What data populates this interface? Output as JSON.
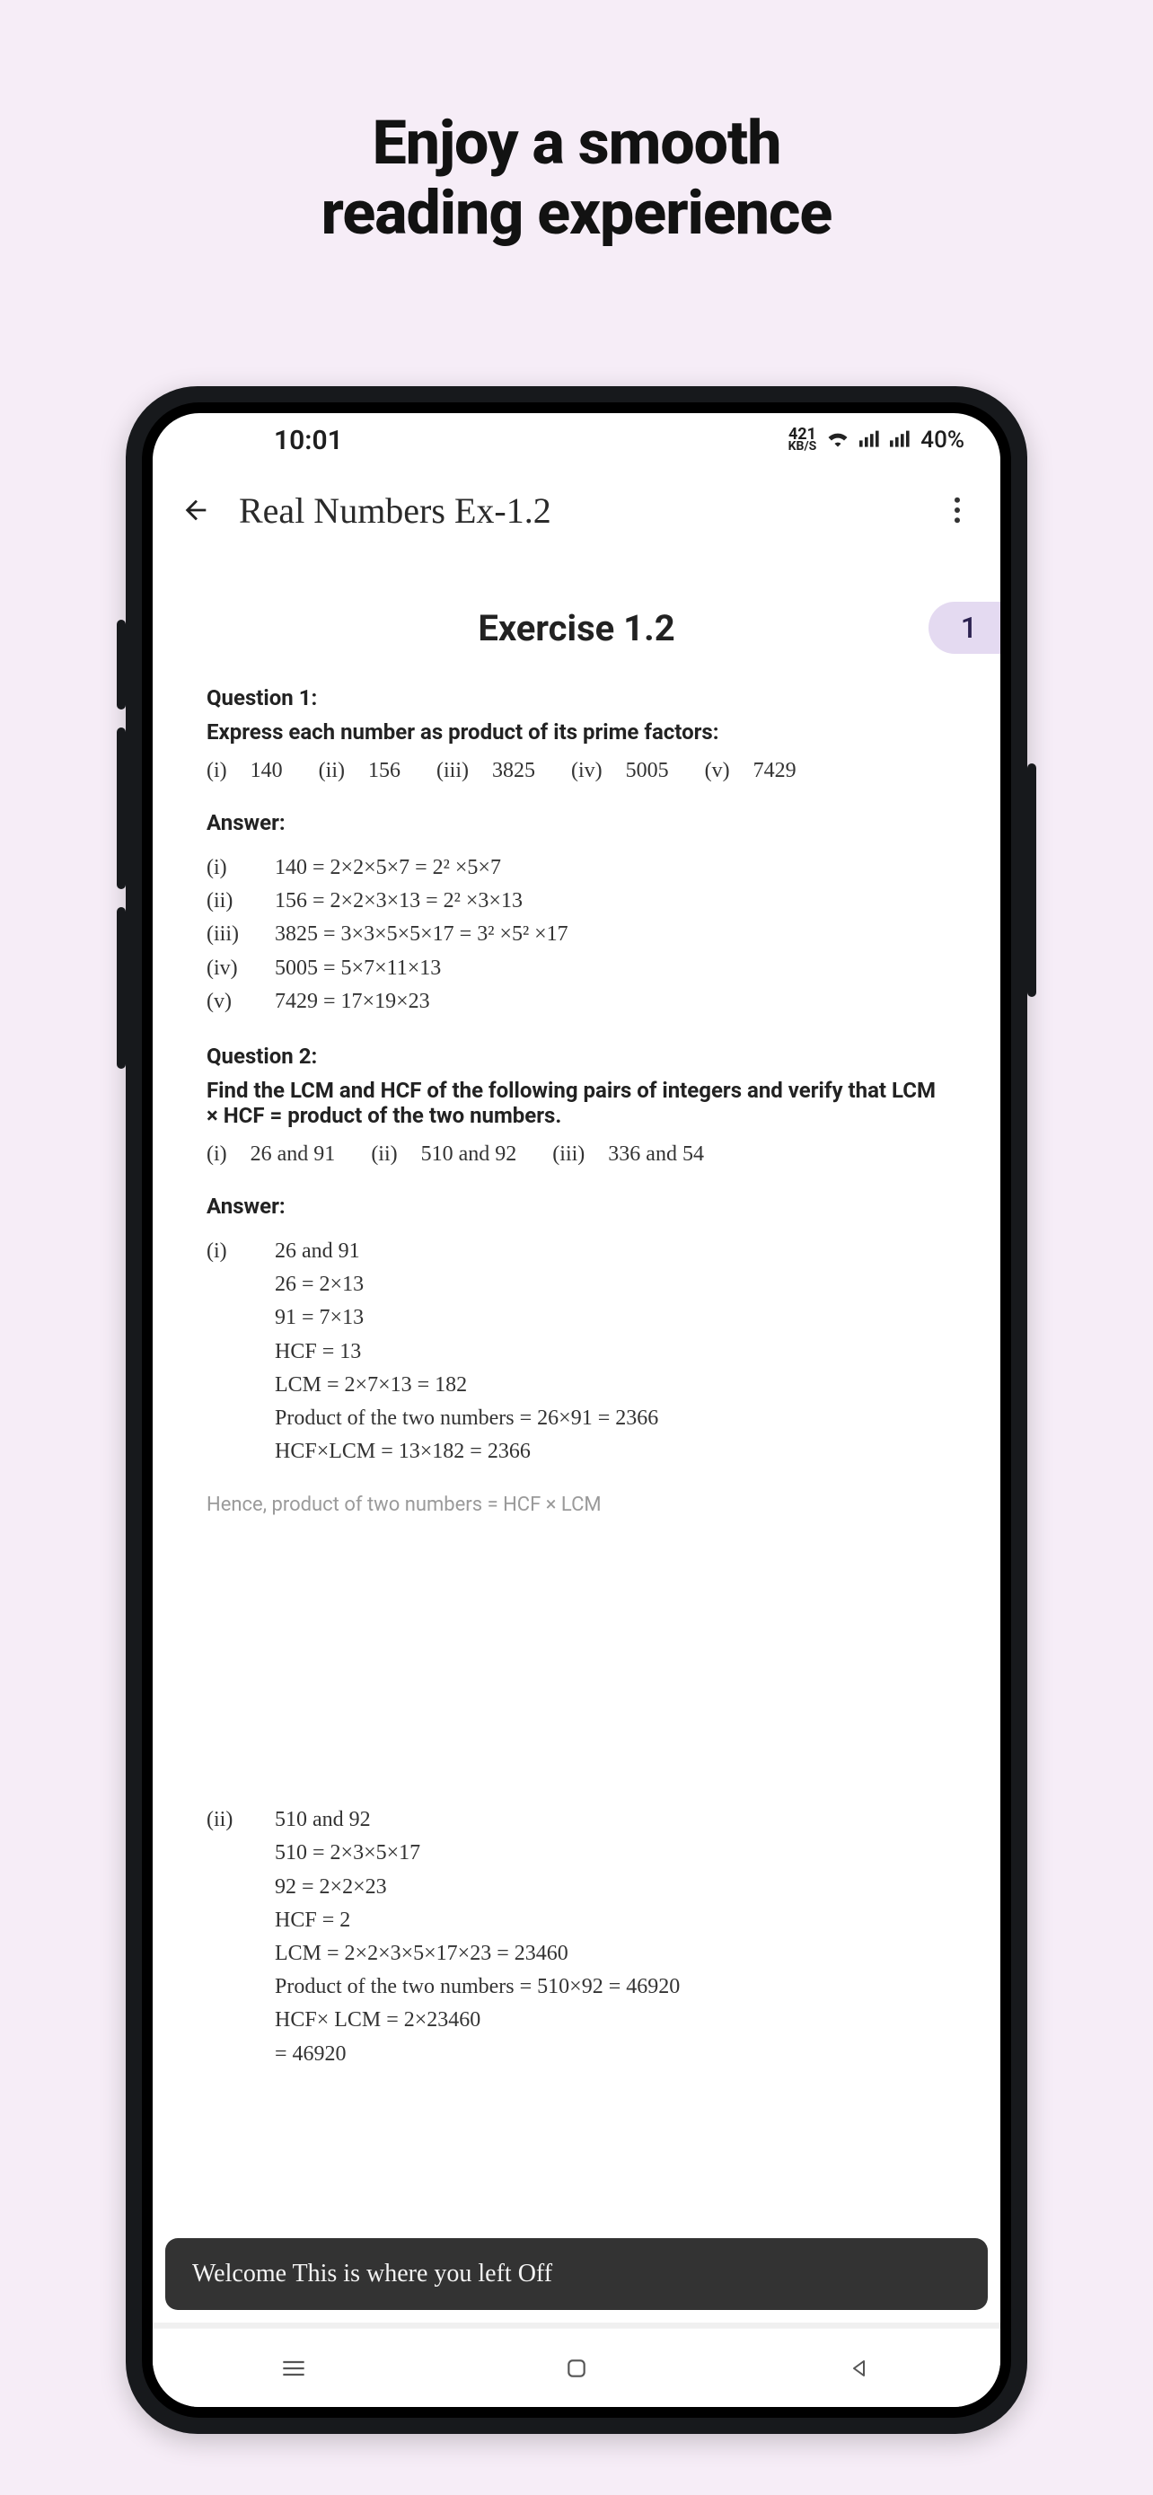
{
  "promo": {
    "line1": "Enjoy a smooth",
    "line2": "reading experience"
  },
  "status": {
    "time": "10:01",
    "kbs_top": "421",
    "kbs_bottom": "KB/S",
    "battery": "40%"
  },
  "appbar": {
    "title": "Real Numbers Ex-1.2"
  },
  "page_chip": "1",
  "content": {
    "title": "Exercise 1.2",
    "q1": {
      "label": "Question 1:",
      "text": "Express each number as product of its prime factors:",
      "opts": [
        {
          "r": "(i)",
          "v": "140"
        },
        {
          "r": "(ii)",
          "v": "156"
        },
        {
          "r": "(iii)",
          "v": "3825"
        },
        {
          "r": "(iv)",
          "v": "5005"
        },
        {
          "r": "(v)",
          "v": "7429"
        }
      ],
      "answer_label": "Answer:",
      "answers": [
        {
          "r": "(i)",
          "t": "140 = 2×2×5×7 = 2² ×5×7"
        },
        {
          "r": "(ii)",
          "t": "156 = 2×2×3×13 = 2² ×3×13"
        },
        {
          "r": "(iii)",
          "t": "3825 = 3×3×5×5×17 = 3² ×5² ×17"
        },
        {
          "r": "(iv)",
          "t": "5005 = 5×7×11×13"
        },
        {
          "r": "(v)",
          "t": "7429 = 17×19×23"
        }
      ]
    },
    "q2": {
      "label": "Question 2:",
      "text": "Find the LCM and HCF of the following pairs of integers and verify that LCM × HCF = product of the two numbers.",
      "opts": [
        {
          "r": "(i)",
          "v": "26 and 91"
        },
        {
          "r": "(ii)",
          "v": "510 and 92"
        },
        {
          "r": "(iii)",
          "v": "336 and 54"
        }
      ],
      "answer_label": "Answer:",
      "ans_i": {
        "r": "(i)",
        "head": "26 and 91",
        "lines": [
          "26 = 2×13",
          "91 = 7×13",
          "HCF = 13",
          "LCM = 2×7×13 = 182",
          "Product of the two numbers = 26×91 = 2366",
          "HCF×LCM = 13×182 = 2366"
        ]
      },
      "hence": "Hence, product of two numbers = HCF × LCM",
      "ans_ii": {
        "r": "(ii)",
        "head": "510 and 92",
        "lines": [
          "510 = 2×3×5×17",
          "92 = 2×2×23",
          "HCF = 2",
          "LCM = 2×2×3×5×17×23 = 23460",
          "Product of the two numbers = 510×92 = 46920",
          "HCF× LCM = 2×23460",
          "           = 46920"
        ]
      }
    }
  },
  "snackbar": "Welcome This is where you left Off"
}
